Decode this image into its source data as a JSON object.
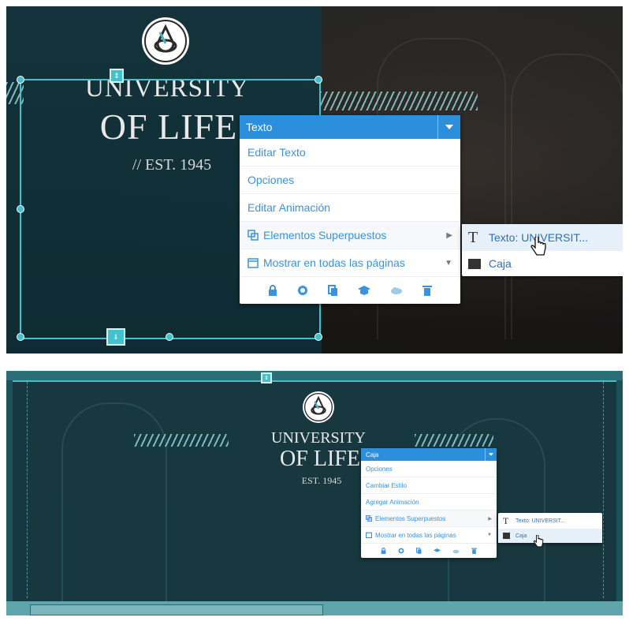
{
  "top": {
    "brand": {
      "line1": "UNIVERSITY",
      "line2": "OF LIFE",
      "line3": "// EST. 1945"
    },
    "menu": {
      "header": "Texto",
      "items": [
        "Editar Texto",
        "Opciones",
        "Editar Animación",
        "Elementos Superpuestos",
        "Mostrar en todas las páginas"
      ],
      "overlap_prefix": "[ ]",
      "submenu": [
        "Texto: UNIVERSIT...",
        "Caja"
      ]
    }
  },
  "bottom": {
    "brand": {
      "line1": "UNIVERSITY",
      "line2": "OF LIFE",
      "line3": "EST. 1945"
    },
    "menu": {
      "header": "Caja",
      "items": [
        "Opciones",
        "Cambiar Estilo",
        "Agregar Animación",
        "Elementos Superpuestos",
        "Mostrar en todas las páginas"
      ],
      "submenu": [
        "Texto: UNIVERSIT...",
        "Caja"
      ]
    }
  },
  "colors": {
    "accent": "#2c8fdc",
    "selection": "#43c1cd",
    "overlay": "#12343c"
  },
  "icons": [
    "lock-icon",
    "layers-icon",
    "copy-icon",
    "hat-icon",
    "cloud-icon",
    "trash-icon",
    "text-t-icon",
    "box-icon",
    "hand-cursor-icon",
    "chevron-down-icon",
    "chevron-right-icon"
  ]
}
